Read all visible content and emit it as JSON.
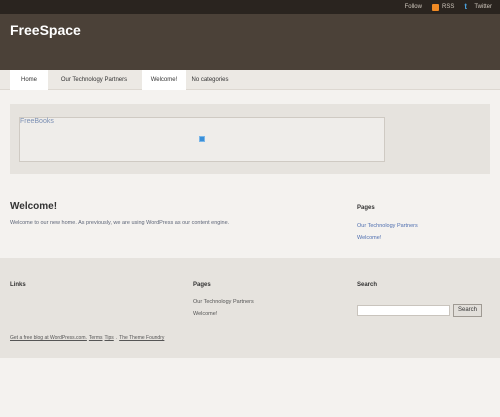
{
  "topbar": {
    "follow": "Follow",
    "rss": "RSS",
    "twitter": "Twitter"
  },
  "header": {
    "site_title": "FreeSpace"
  },
  "nav": {
    "home": "Home",
    "partners": "Our Technology Partners",
    "welcome": "Welcome!",
    "no_categories": "No categories"
  },
  "feature": {
    "title": "FreeBooks"
  },
  "post": {
    "title": "Welcome!",
    "body": "Welcome to our new home. As previously, we are using WordPress as our content engine."
  },
  "sidebar": {
    "heading": "Pages",
    "links": [
      "Our Technology Partners",
      "Welcome!"
    ]
  },
  "footer": {
    "links_heading": "Links",
    "pages_heading": "Pages",
    "pages_links": [
      "Our Technology Partners",
      "Welcome!"
    ],
    "search_heading": "Search",
    "search_button": "Search",
    "search_value": "",
    "credit": {
      "blog": "Get a free blog at WordPress.com.",
      "terms": "Terms",
      "tips": "Tips",
      "sep": ".",
      "theme": "The Theme Foundry"
    }
  },
  "colors": {
    "topbar": "#2a241f",
    "header": "#4b4138",
    "link": "#4f6fb0",
    "rss": "#f08a24",
    "twitter": "#4aa3df"
  }
}
